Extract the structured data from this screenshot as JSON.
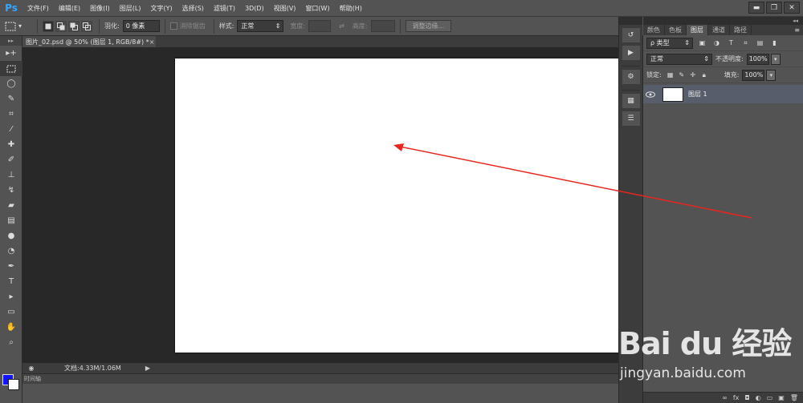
{
  "app": {
    "logo": "Ps",
    "menu": [
      "文件(F)",
      "编辑(E)",
      "图像(I)",
      "图层(L)",
      "文字(Y)",
      "选择(S)",
      "滤镜(T)",
      "3D(D)",
      "视图(V)",
      "窗口(W)",
      "帮助(H)"
    ],
    "window_controls": {
      "minimize": "▬",
      "restore": "❐",
      "close": "✕"
    }
  },
  "options": {
    "feather_label": "羽化:",
    "feather_value": "0 像素",
    "antialias_label": "消除锯齿",
    "style_label": "样式:",
    "style_value": "正常",
    "width_label": "宽度:",
    "height_label": "高度:",
    "swap_glyph": "⇄",
    "refine_edge_label": "调整边缘..."
  },
  "document": {
    "tab_title": "图片_02.psd @ 50% (图层 1, RGB/8#) *",
    "close_glyph": "×",
    "status_info": "文档:4.33M/1.06M",
    "status_arrow": "▶",
    "timeline_label": "时间轴"
  },
  "panels": {
    "tabs": [
      "颜色",
      "色板",
      "图层",
      "通道",
      "路径"
    ],
    "active_tab": "图层",
    "filter_label": "ρ 类型",
    "blend_mode": "正常",
    "opacity_label": "不透明度:",
    "opacity_value": "100%",
    "lock_label": "锁定:",
    "fill_label": "填充:",
    "fill_value": "100%",
    "layers": [
      {
        "name": "图层 1",
        "visible_glyph": "👁"
      }
    ],
    "bottom_icons": [
      "∞",
      "fx",
      "◘",
      "◐",
      "▭",
      "▣",
      "🗑"
    ]
  },
  "watermark": {
    "logo_text": "Bai du 经验",
    "url": "jingyan.baidu.com"
  },
  "colors": {
    "foreground": "#1212ff",
    "background": "#ffffff",
    "annotation_arrow": "#e8261f"
  }
}
